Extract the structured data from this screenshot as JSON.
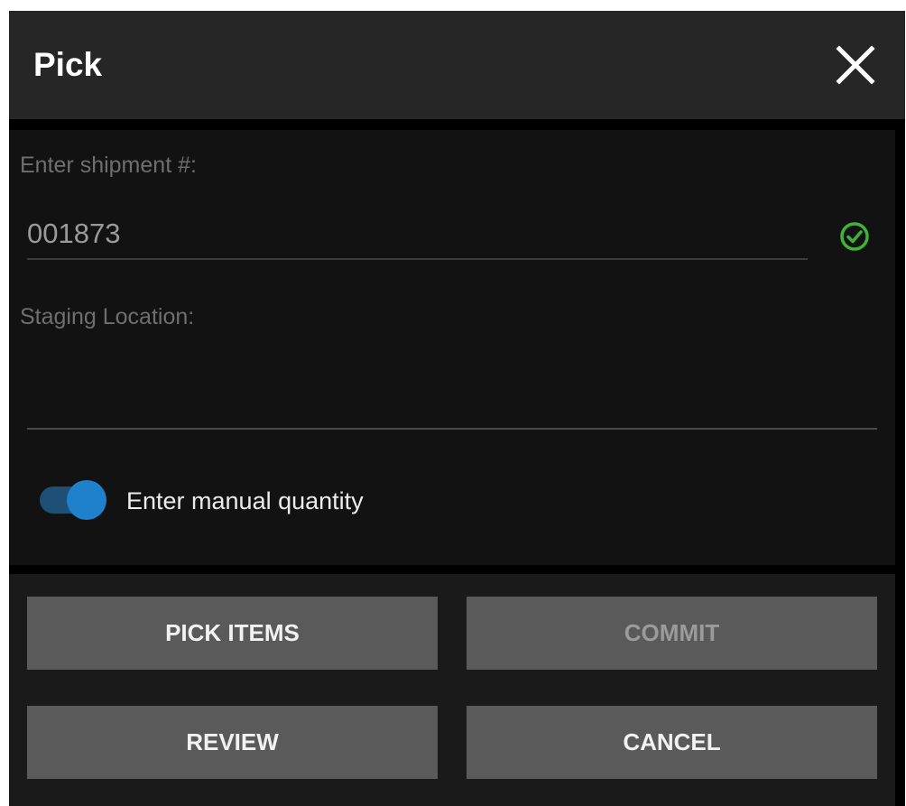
{
  "dialog": {
    "title": "Pick",
    "close_icon": "close-icon"
  },
  "form": {
    "shipment": {
      "label": "Enter shipment #:",
      "value": "001873",
      "status_icon": "check-circle-icon",
      "status_color": "#3fb23a"
    },
    "staging": {
      "label": "Staging Location:",
      "value": ""
    },
    "manual_quantity": {
      "label": "Enter manual quantity",
      "enabled": true,
      "accent_color": "#1f80cc"
    }
  },
  "actions": {
    "pick_items": "PICK ITEMS",
    "commit": "COMMIT",
    "review": "REVIEW",
    "cancel": "CANCEL"
  }
}
